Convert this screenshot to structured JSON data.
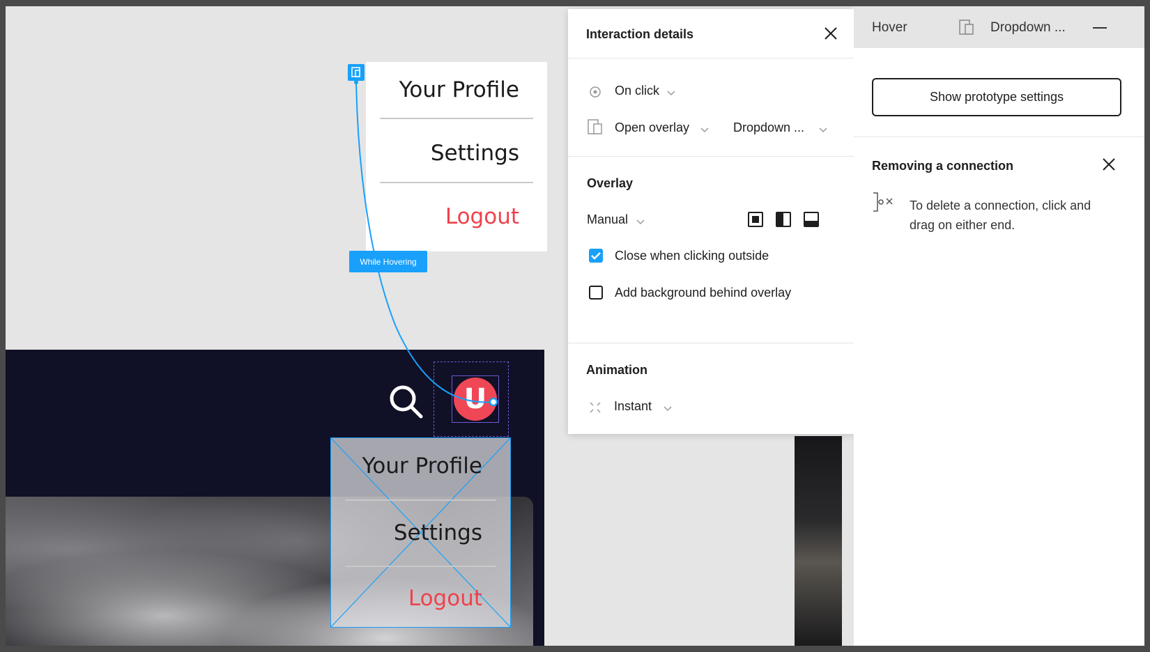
{
  "canvas": {
    "menu": [
      "Your Profile",
      "Settings",
      "Logout"
    ],
    "connection_label": "While Hovering",
    "avatar_letter": "U",
    "overlay_menu": [
      "Your Profile",
      "Settings",
      "Logout"
    ],
    "accent_color": "#18a0fb",
    "logout_color": "#f0414b"
  },
  "interaction": {
    "title": "Interaction details",
    "trigger": "On click",
    "action": "Open overlay",
    "destination": "Dropdown ...",
    "overlay": {
      "title": "Overlay",
      "position": "Manual",
      "close_outside_label": "Close when clicking outside",
      "close_outside_checked": true,
      "background_label": "Add background behind overlay",
      "background_checked": false
    },
    "animation": {
      "title": "Animation",
      "type": "Instant"
    }
  },
  "sidebar": {
    "trigger_label": "Hover",
    "destination_label": "Dropdown ...",
    "prototype_button": "Show prototype settings",
    "tip_title": "Removing a connection",
    "tip_text": "To delete a connection, click and drag on either end."
  }
}
